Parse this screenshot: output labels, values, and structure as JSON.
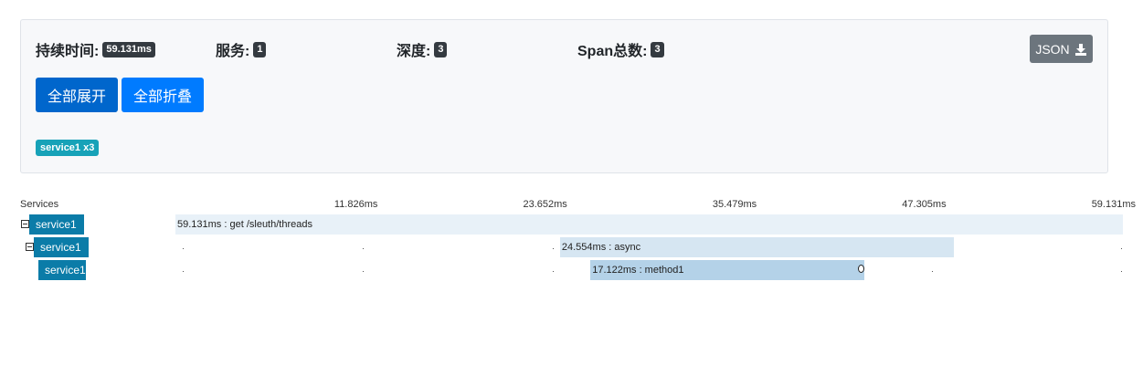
{
  "summary": {
    "duration_label": "持续时间:",
    "duration_value": "59.131ms",
    "services_label": "服务:",
    "services_value": "1",
    "depth_label": "深度:",
    "depth_value": "3",
    "spans_label": "Span总数:",
    "spans_value": "3",
    "json_button": "JSON",
    "json_icon": "download-icon",
    "expand_all": "全部展开",
    "collapse_all": "全部折叠",
    "service_tag": "service1 x3"
  },
  "timeline": {
    "services_header": "Services",
    "ticks": [
      "11.826ms",
      "23.652ms",
      "35.479ms",
      "47.305ms",
      "59.131ms"
    ],
    "total_ms": 59.131,
    "spans": [
      {
        "service": "service1",
        "label": "59.131ms : get /sleuth/threads",
        "start_ms": 0,
        "duration_ms": 59.131,
        "depth": 0,
        "collapsible": true
      },
      {
        "service": "service1",
        "label": "24.554ms : async",
        "start_ms": 24.0,
        "duration_ms": 24.554,
        "depth": 1,
        "collapsible": true
      },
      {
        "service": "service1",
        "label": "17.122ms : method1",
        "start_ms": 25.9,
        "duration_ms": 17.122,
        "depth": 2,
        "collapsible": false
      }
    ]
  },
  "colors": {
    "primary": "#007bff",
    "primary_active": "#0066cc",
    "secondary": "#6c757d",
    "badge_dark": "#343a40",
    "service_tag": "#17a2b8",
    "service_name_bg": "#0b7ca8",
    "span_bar_0": "#e8f1f8",
    "span_bar_1": "#d6e6f2",
    "span_bar_2": "#b4d2e8"
  }
}
